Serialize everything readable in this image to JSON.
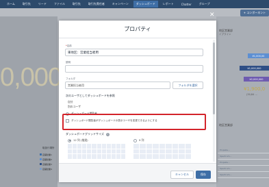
{
  "top_nav": {
    "items": [
      "ホーム",
      "取引先",
      "リード",
      "ファイル",
      "取引先",
      "取引先責任者",
      "キャンペーン",
      "ダッシュボード",
      "レポート",
      "Chatter",
      "グループ"
    ],
    "active_index": 7
  },
  "background": {
    "big_number": "0,000",
    "add_component_label": "+ コンポーネント",
    "right_title": "地区営業部",
    "right_sub": "イプライン",
    "right_chips": [
      "¥1,000,00",
      "¥1,000,000",
      "¥2,000,000"
    ],
    "right_yellow": "¥1,900,0",
    "right_yellow_sub": "(30,84 …",
    "right_title2": "地区営業部",
    "right_table": [
      "Propelle...",
      "Spectrum...",
      "Propelle...",
      "Spectrum...",
      "Spectrum..."
    ],
    "left_label": "取扱行場所",
    "left_legend": [
      "店舗営業1",
      "店舗営業2",
      "店舗営業3",
      "店舗営業4"
    ]
  },
  "modal": {
    "title": "プロパティ",
    "name_label": "名前",
    "name_value": "東地区：営業担当者用",
    "description_label": "説明",
    "folder_label": "フォルダ",
    "folder_value": "営業担当者用",
    "folder_button": "フォルダを選択",
    "view_as_label": "次のユーザとしてダッシュボードを参照",
    "view_as_options": [
      "自分",
      "別のユーザ",
      "ダッシュボード閲覧者"
    ],
    "view_as_selected": 2,
    "checkbox_label": "ダッシュボード閲覧者がダッシュボードの表示ユーザを変更できるようにする",
    "grid_size_label": "ダッシュボードグリッドサイズ",
    "grid_options": [
      "12 列 (推奨)",
      "9 列"
    ],
    "grid_selected": 0,
    "cancel_button": "キャンセル",
    "save_button": "保存"
  },
  "colors": {
    "primary": "#3e6ea6",
    "highlight": "#d3232a",
    "chip1": "#5d8fd2",
    "chip2": "#2f4f86",
    "chip3": "#6e5bb0"
  }
}
